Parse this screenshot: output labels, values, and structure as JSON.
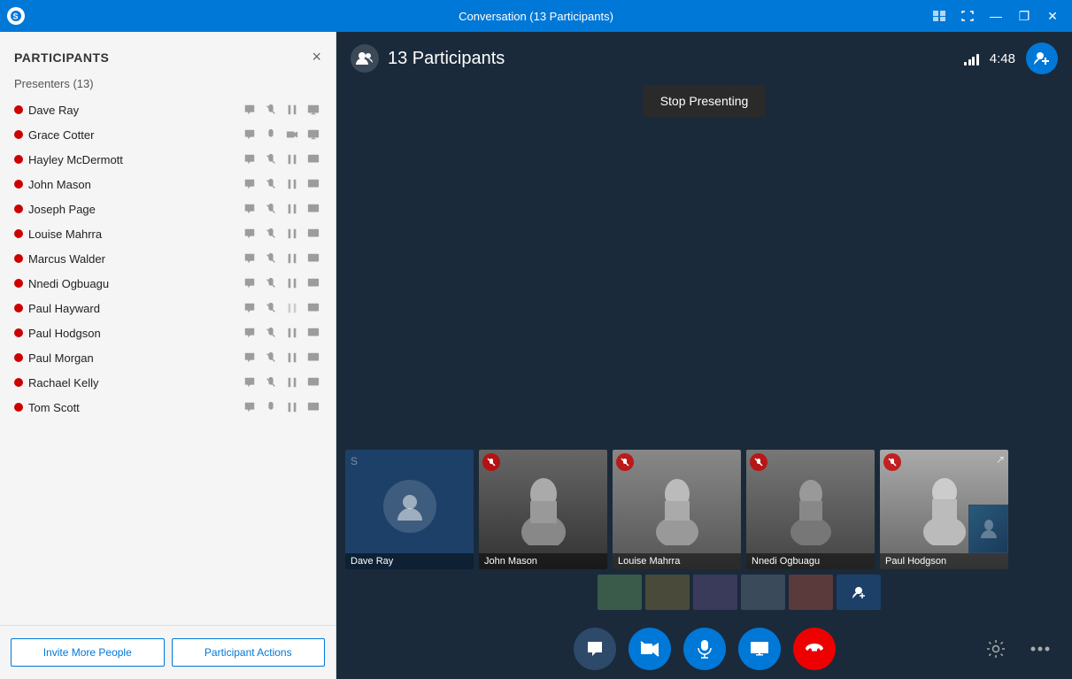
{
  "titleBar": {
    "title": "Conversation (13 Participants)",
    "controls": [
      "snap-icon",
      "maximize-icon",
      "minimize-icon",
      "restore-icon",
      "close-icon"
    ]
  },
  "sidebar": {
    "title": "PARTICIPANTS",
    "presentersLabel": "Presenters (13)",
    "closeLabel": "×",
    "participants": [
      {
        "name": "Dave Ray",
        "status": "presenter"
      },
      {
        "name": "Grace Cotter",
        "status": "presenter"
      },
      {
        "name": "Hayley McDermott",
        "status": "presenter"
      },
      {
        "name": "John Mason",
        "status": "presenter"
      },
      {
        "name": "Joseph Page",
        "status": "presenter"
      },
      {
        "name": "Louise Mahrra",
        "status": "presenter"
      },
      {
        "name": "Marcus Walder",
        "status": "presenter"
      },
      {
        "name": "Nnedi Ogbuagu",
        "status": "presenter"
      },
      {
        "name": "Paul Hayward",
        "status": "presenter"
      },
      {
        "name": "Paul Hodgson",
        "status": "presenter"
      },
      {
        "name": "Paul Morgan",
        "status": "presenter"
      },
      {
        "name": "Rachael Kelly",
        "status": "presenter"
      },
      {
        "name": "Tom Scott",
        "status": "presenter"
      }
    ],
    "inviteButton": "Invite More People",
    "actionsButton": "Participant Actions"
  },
  "videoArea": {
    "participantCount": "13 Participants",
    "timer": "4:48",
    "stopPresentingLabel": "Stop Presenting",
    "videoTiles": [
      {
        "name": "Dave Ray",
        "type": "presenter-placeholder",
        "muted": false
      },
      {
        "name": "John Mason",
        "type": "photo",
        "muted": true
      },
      {
        "name": "Louise Mahrra",
        "type": "photo",
        "muted": true
      },
      {
        "name": "Nnedi Ogbuagu",
        "type": "photo",
        "muted": true
      },
      {
        "name": "Paul Hodgson",
        "type": "photo",
        "muted": true
      }
    ],
    "bottomBar": {
      "chatLabel": "💬",
      "videoMutedLabel": "🎥",
      "micLabel": "🎤",
      "screenLabel": "🖥",
      "endCallLabel": "📞"
    }
  }
}
